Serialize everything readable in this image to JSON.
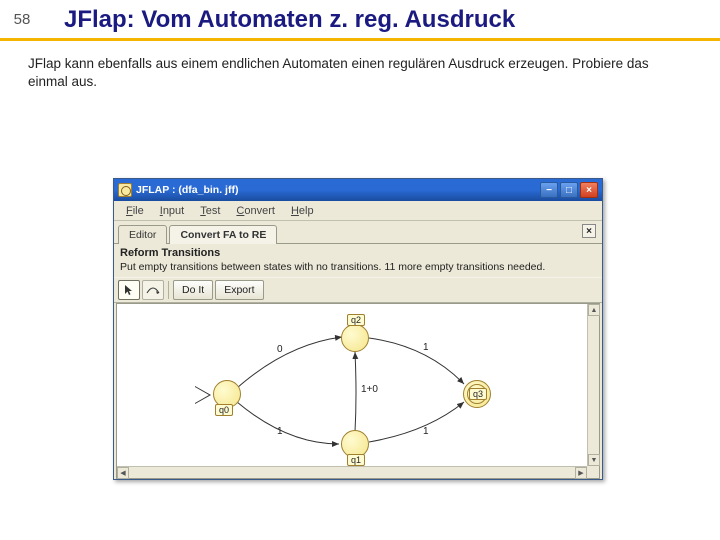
{
  "slide": {
    "number": "58",
    "title": "JFlap: Vom Automaten z. reg. Ausdruck",
    "body": "JFlap kann ebenfalls aus einem endlichen Automaten einen regulären Ausdruck erzeugen. Probiere das einmal aus."
  },
  "app": {
    "title": "JFLAP : (dfa_bin. jff)",
    "menu": {
      "file": "File",
      "input": "Input",
      "test": "Test",
      "convert": "Convert",
      "help": "Help"
    },
    "tabs": {
      "editor": "Editor",
      "convert": "Convert FA to RE"
    },
    "panel": {
      "title": "Reform Transitions",
      "instr": "Put empty transitions between states with no transitions. 11 more empty transitions needed."
    },
    "toolbar": {
      "doit": "Do It",
      "export": "Export"
    },
    "states": {
      "q0": "q0",
      "q1": "q1",
      "q2": "q2",
      "q3": "q3"
    },
    "edges": {
      "q0_q2": "0",
      "q0_q1": "1",
      "q1_q2": "1+0",
      "q2_q3": "1",
      "q1_q3": "1"
    }
  }
}
